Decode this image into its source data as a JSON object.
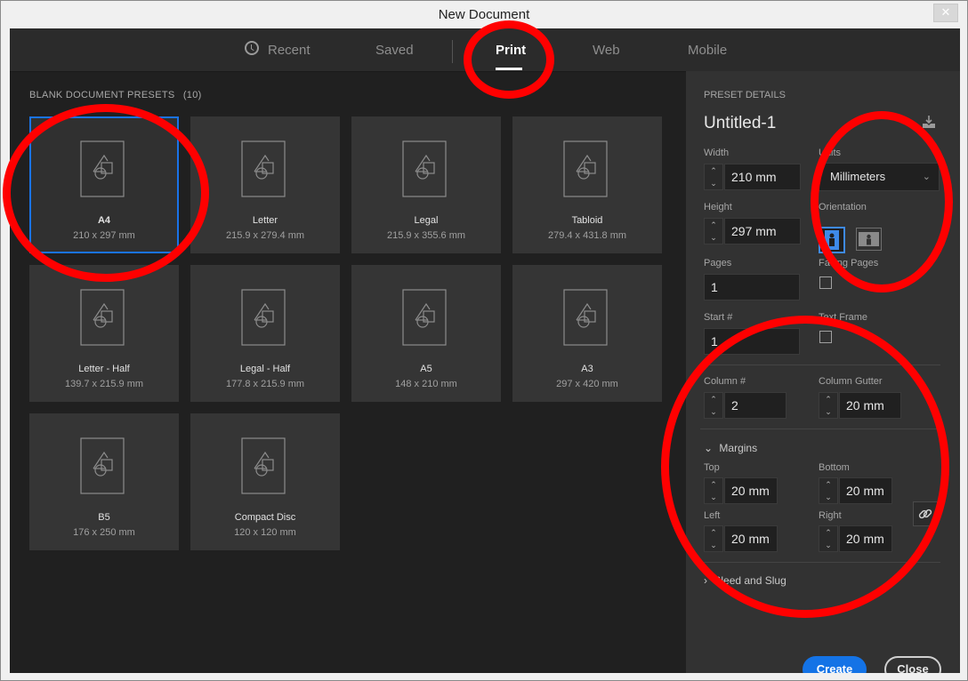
{
  "window": {
    "title": "New Document",
    "close_glyph": "✕"
  },
  "tabs": [
    {
      "label": "Recent",
      "icon": "clock-icon"
    },
    {
      "label": "Saved"
    },
    {
      "label": "Print",
      "active": true
    },
    {
      "label": "Web"
    },
    {
      "label": "Mobile"
    }
  ],
  "presets": {
    "section_title": "BLANK DOCUMENT PRESETS",
    "count": "(10)",
    "items": [
      {
        "name": "A4",
        "size": "210 x 297 mm",
        "selected": true
      },
      {
        "name": "Letter",
        "size": "215.9 x 279.4 mm"
      },
      {
        "name": "Legal",
        "size": "215.9 x 355.6 mm"
      },
      {
        "name": "Tabloid",
        "size": "279.4 x 431.8 mm"
      },
      {
        "name": "Letter - Half",
        "size": "139.7 x 215.9 mm"
      },
      {
        "name": "Legal - Half",
        "size": "177.8 x 215.9 mm"
      },
      {
        "name": "A5",
        "size": "148 x 210 mm"
      },
      {
        "name": "A3",
        "size": "297 x 420 mm"
      },
      {
        "name": "B5",
        "size": "176 x 250 mm"
      },
      {
        "name": "Compact Disc",
        "size": "120 x 120 mm"
      }
    ]
  },
  "details": {
    "header": "PRESET DETAILS",
    "doc_name": "Untitled-1",
    "width": {
      "label": "Width",
      "value": "210 mm"
    },
    "height": {
      "label": "Height",
      "value": "297 mm"
    },
    "units": {
      "label": "Units",
      "value": "Millimeters"
    },
    "orientation": {
      "label": "Orientation",
      "selected": "portrait"
    },
    "pages": {
      "label": "Pages",
      "value": "1"
    },
    "facing_pages": {
      "label": "Facing Pages",
      "checked": false
    },
    "start": {
      "label": "Start #",
      "value": "1"
    },
    "text_frame": {
      "label": "Text Frame",
      "checked": false
    },
    "column_count": {
      "label": "Column #",
      "value": "2"
    },
    "column_gutter": {
      "label": "Column Gutter",
      "value": "20 mm"
    },
    "margins": {
      "label": "Margins",
      "top": {
        "label": "Top",
        "value": "20 mm"
      },
      "bottom": {
        "label": "Bottom",
        "value": "20 mm"
      },
      "left": {
        "label": "Left",
        "value": "20 mm"
      },
      "right": {
        "label": "Right",
        "value": "20 mm"
      }
    },
    "bleed_slug": {
      "label": "Bleed and Slug"
    }
  },
  "buttons": {
    "create": "Create",
    "close": "Close"
  },
  "colors": {
    "accent": "#1473e6",
    "annotation": "#ff0000"
  },
  "stepper_glyphs": {
    "up": "⌃",
    "down": "⌄",
    "chevron": "⌄",
    "expanded": "⌄",
    "collapsed": "›"
  }
}
